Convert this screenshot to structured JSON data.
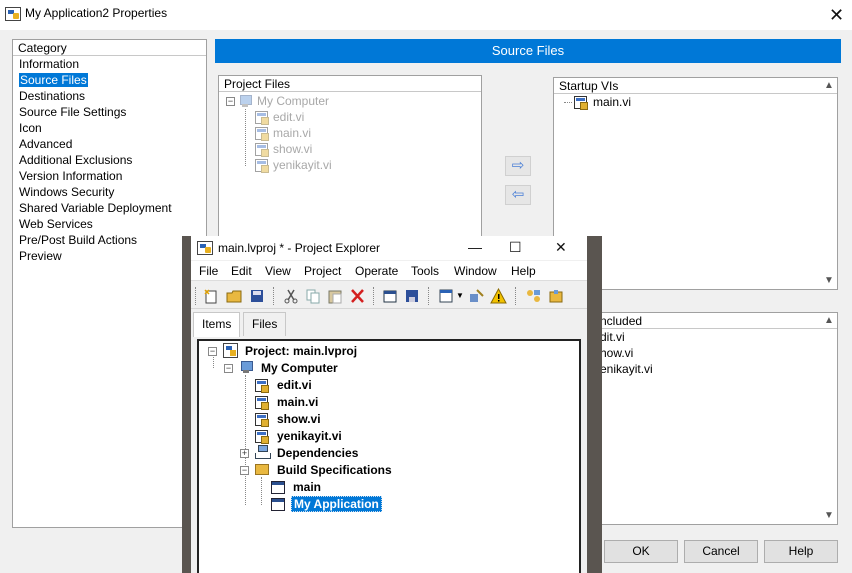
{
  "props_window": {
    "title": "My Application2 Properties",
    "close_label": "✕"
  },
  "category": {
    "header": "Category",
    "items": [
      "Information",
      "Source Files",
      "Destinations",
      "Source File Settings",
      "Icon",
      "Advanced",
      "Additional Exclusions",
      "Version Information",
      "Windows Security",
      "Shared Variable Deployment",
      "Web Services",
      "Pre/Post Build Actions",
      "Preview"
    ],
    "selected": "Source Files"
  },
  "section_title": "Source Files",
  "project_files": {
    "header": "Project Files",
    "root": "My Computer",
    "files": [
      "edit.vi",
      "main.vi",
      "show.vi",
      "yenikayit.vi"
    ]
  },
  "move_buttons": {
    "add": "⇨",
    "remove": "⇦"
  },
  "startup_vis": {
    "header": "Startup VIs",
    "items": [
      "main.vi"
    ]
  },
  "always_included": {
    "header_visible": "ncluded",
    "items_visible": [
      "dit.vi",
      "how.vi",
      "enikayit.vi"
    ]
  },
  "dialog_buttons": {
    "ok": "OK",
    "cancel": "Cancel",
    "help": "Help"
  },
  "explorer": {
    "title": "main.lvproj * - Project Explorer",
    "controls": {
      "minimize": "—",
      "maximize": "☐",
      "close": "✕"
    },
    "menu": [
      "File",
      "Edit",
      "View",
      "Project",
      "Operate",
      "Tools",
      "Window",
      "Help"
    ],
    "tabs": [
      "Items",
      "Files"
    ],
    "active_tab": "Items",
    "tree": {
      "project": "Project: main.lvproj",
      "computer": "My Computer",
      "files": [
        "edit.vi",
        "main.vi",
        "show.vi",
        "yenikayit.vi"
      ],
      "dependencies": "Dependencies",
      "build_specs": "Build Specifications",
      "builds": [
        "main",
        "My Application"
      ],
      "selected": "My Application"
    }
  },
  "colors": {
    "accent": "#0078d7",
    "window_bg": "#f0f0f0",
    "disabled_text": "#a8a8a8"
  }
}
